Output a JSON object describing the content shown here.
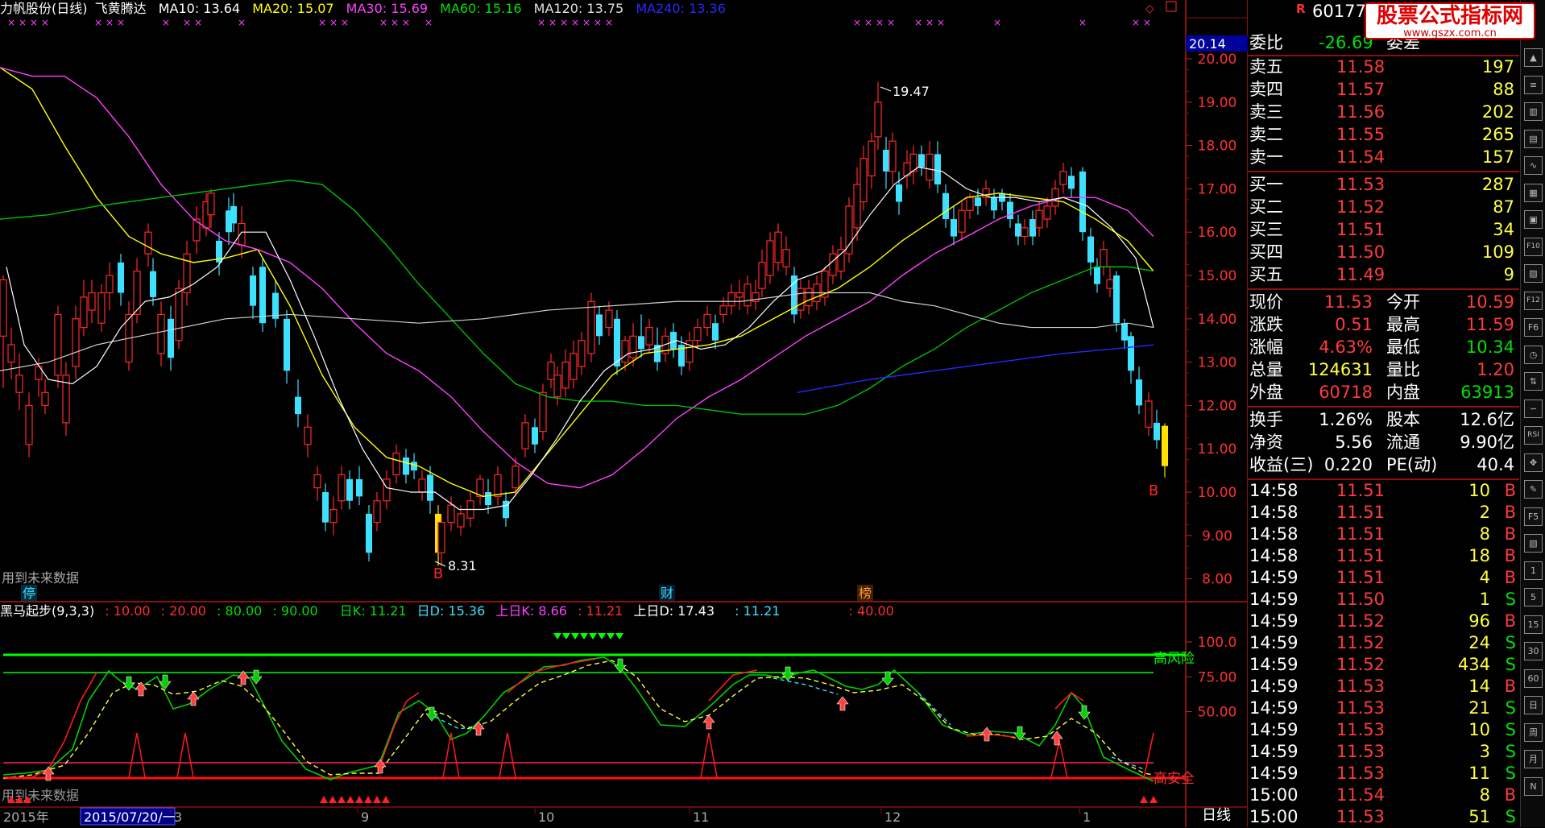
{
  "window": {
    "stock_name": "力帆股份(日线)",
    "indicator_name": "飞黄腾达"
  },
  "ma_legend": [
    {
      "label": "MA10: 13.64",
      "color": "#ffffff"
    },
    {
      "label": "MA20: 15.07",
      "color": "#ffff00"
    },
    {
      "label": "MA30: 15.69",
      "color": "#ff40ff"
    },
    {
      "label": "MA60: 15.16",
      "color": "#00e000"
    },
    {
      "label": "MA120: 13.75",
      "color": "#e0e0e0"
    },
    {
      "label": "MA240: 13.36",
      "color": "#2828ff"
    }
  ],
  "main_chart": {
    "price_axis": [
      "20.00",
      "19.00",
      "18.00",
      "17.00",
      "16.00",
      "15.00",
      "14.00",
      "13.00",
      "12.00",
      "11.00",
      "10.00",
      "9.00",
      "8.00"
    ],
    "current_marker": "20.14",
    "high_note": "19.47",
    "low_note": "8.31",
    "future_note": "用到未来数据",
    "event_labels": [
      {
        "text": "停"
      },
      {
        "text": "财"
      },
      {
        "text": "榜"
      }
    ],
    "signal_letter": "B"
  },
  "sub_chart": {
    "title": "黑马起步(9,3,3)",
    "params": [
      {
        "label": ": 10.00",
        "color": "#ff3030"
      },
      {
        "label": ": 20.00",
        "color": "#ff3030"
      },
      {
        "label": ": 80.00",
        "color": "#00e000"
      },
      {
        "label": ": 90.00",
        "color": "#00e000"
      },
      {
        "label": "日K: 11.21",
        "color": "#00e000"
      },
      {
        "label": "日D: 15.36",
        "color": "#3ee0ff"
      },
      {
        "label": "上日K: 8.66",
        "color": "#ff40ff"
      },
      {
        "label": ": 11.21",
        "color": "#ff3030"
      },
      {
        "label": "上日D: 17.43",
        "color": "#ffffff"
      },
      {
        "label": ": 11.21",
        "color": "#3ee0ff"
      },
      {
        "label": ": 40.00",
        "color": "#ff3030"
      }
    ],
    "axis": [
      "100.0",
      "75.00",
      "50.00"
    ],
    "high_risk_label": "高风险",
    "high_safe_label": "高安全",
    "future_note": "用到未来数据"
  },
  "date_axis": {
    "year_label": "2015年",
    "cursor_date": "2015/07/20/一",
    "months": [
      "3",
      "9",
      "10",
      "11",
      "12",
      "1"
    ],
    "period": "日线"
  },
  "quote_panel": {
    "marker": "R",
    "code": "601777",
    "wei_bi_label": "委比",
    "wei_bi_value": "-26.69",
    "wei_cha_label": "委差",
    "sells": [
      {
        "label": "卖五",
        "price": "11.58",
        "vol": "197"
      },
      {
        "label": "卖四",
        "price": "11.57",
        "vol": "88"
      },
      {
        "label": "卖三",
        "price": "11.56",
        "vol": "202"
      },
      {
        "label": "卖二",
        "price": "11.55",
        "vol": "265"
      },
      {
        "label": "卖一",
        "price": "11.54",
        "vol": "157"
      }
    ],
    "buys": [
      {
        "label": "买一",
        "price": "11.53",
        "vol": "287"
      },
      {
        "label": "买二",
        "price": "11.52",
        "vol": "87"
      },
      {
        "label": "买三",
        "price": "11.51",
        "vol": "34"
      },
      {
        "label": "买四",
        "price": "11.50",
        "vol": "109"
      },
      {
        "label": "买五",
        "price": "11.49",
        "vol": "9"
      }
    ],
    "stats": [
      {
        "l1": "现价",
        "v1": "11.53",
        "c1": "#ff3b3b",
        "l2": "今开",
        "v2": "10.59",
        "c2": "#ff3b3b"
      },
      {
        "l1": "涨跌",
        "v1": "0.51",
        "c1": "#ff3b3b",
        "l2": "最高",
        "v2": "11.59",
        "c2": "#ff3b3b"
      },
      {
        "l1": "涨幅",
        "v1": "4.63%",
        "c1": "#ff3b3b",
        "l2": "最低",
        "v2": "10.34",
        "c2": "#00e000"
      },
      {
        "l1": "总量",
        "v1": "124631",
        "c1": "#ffff40",
        "l2": "量比",
        "v2": "1.20",
        "c2": "#ff3b3b"
      },
      {
        "l1": "外盘",
        "v1": "60718",
        "c1": "#ff3b3b",
        "l2": "内盘",
        "v2": "63913",
        "c2": "#00e000"
      }
    ],
    "fundamentals": [
      {
        "l1": "换手",
        "v1": "1.26%",
        "l2": "股本",
        "v2": "12.6亿"
      },
      {
        "l1": "净资",
        "v1": "5.56",
        "l2": "流通",
        "v2": "9.90亿"
      },
      {
        "l1": "收益(三)",
        "v1": "0.220",
        "l2": "PE(动)",
        "v2": "40.4"
      }
    ],
    "ticks": [
      {
        "time": "14:58",
        "price": "11.51",
        "vol": "10",
        "side": "B"
      },
      {
        "time": "14:58",
        "price": "11.51",
        "vol": "2",
        "side": "B"
      },
      {
        "time": "14:58",
        "price": "11.51",
        "vol": "8",
        "side": "B"
      },
      {
        "time": "14:58",
        "price": "11.51",
        "vol": "18",
        "side": "B"
      },
      {
        "time": "14:59",
        "price": "11.51",
        "vol": "4",
        "side": "B"
      },
      {
        "time": "14:59",
        "price": "11.50",
        "vol": "1",
        "side": "S"
      },
      {
        "time": "14:59",
        "price": "11.52",
        "vol": "96",
        "side": "B"
      },
      {
        "time": "14:59",
        "price": "11.52",
        "vol": "24",
        "side": "S"
      },
      {
        "time": "14:59",
        "price": "11.52",
        "vol": "434",
        "side": "S"
      },
      {
        "time": "14:59",
        "price": "11.53",
        "vol": "14",
        "side": "B"
      },
      {
        "time": "14:59",
        "price": "11.53",
        "vol": "21",
        "side": "S"
      },
      {
        "time": "14:59",
        "price": "11.53",
        "vol": "10",
        "side": "S"
      },
      {
        "time": "14:59",
        "price": "11.53",
        "vol": "3",
        "side": "S"
      },
      {
        "time": "14:59",
        "price": "11.53",
        "vol": "11",
        "side": "S"
      },
      {
        "time": "15:00",
        "price": "11.54",
        "vol": "8",
        "side": "B"
      },
      {
        "time": "15:00",
        "price": "11.53",
        "vol": "51",
        "side": "S"
      }
    ]
  },
  "logo": {
    "title": "股票公式指标网",
    "url": "www.gszx.com.cn"
  },
  "toolbar": [
    {
      "icon": "up-arrow-icon",
      "label": "▲"
    },
    {
      "icon": "list-icon",
      "label": "≡"
    },
    {
      "icon": "bar-icon",
      "label": "▥"
    },
    {
      "icon": "candle-icon",
      "label": "▤"
    },
    {
      "icon": "line-icon",
      "label": "∿"
    },
    {
      "icon": "grid-icon",
      "label": "▦"
    },
    {
      "icon": "table-icon",
      "label": "▣"
    },
    {
      "icon": "f10-icon",
      "label": "F10"
    },
    {
      "icon": "chart-icon",
      "label": "▨"
    },
    {
      "icon": "f12-icon",
      "label": "F12"
    },
    {
      "icon": "f6-icon",
      "label": "F6"
    },
    {
      "icon": "clock-icon",
      "label": "◷"
    },
    {
      "icon": "compare-icon",
      "label": "⇅"
    },
    {
      "icon": "signal-icon",
      "label": "∽"
    },
    {
      "icon": "rsi-icon",
      "label": "RSI"
    },
    {
      "icon": "move-icon",
      "label": "✥"
    },
    {
      "icon": "pen-icon",
      "label": "✎"
    },
    {
      "icon": "f5-icon",
      "label": "F5"
    },
    {
      "icon": "image-icon",
      "label": "▧"
    },
    {
      "icon": "min1-icon",
      "label": "1"
    },
    {
      "icon": "min5-icon",
      "label": "5"
    },
    {
      "icon": "min15-icon",
      "label": "15"
    },
    {
      "icon": "min30-icon",
      "label": "30"
    },
    {
      "icon": "min60-icon",
      "label": "60"
    },
    {
      "icon": "day-icon",
      "label": "日"
    },
    {
      "icon": "week-icon",
      "label": "周"
    },
    {
      "icon": "month-icon",
      "label": "月"
    },
    {
      "icon": "quarter-icon",
      "label": "N"
    }
  ]
}
